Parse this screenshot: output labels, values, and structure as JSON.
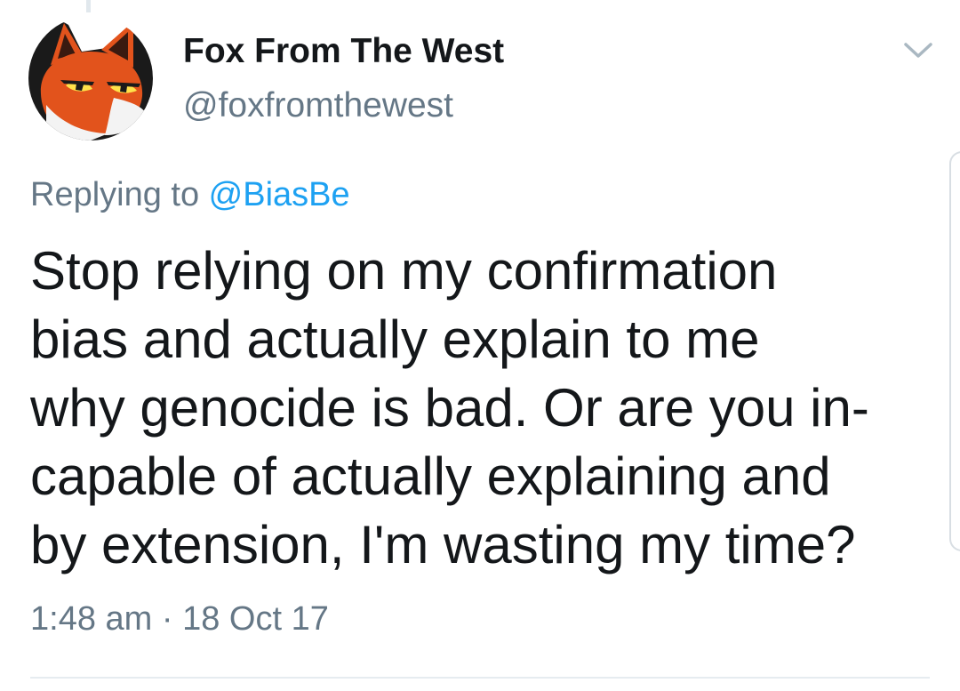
{
  "tweet": {
    "author": {
      "display_name": "Fox From The West",
      "handle": "@foxfromthewest",
      "avatar_icon": "fox-avatar-icon"
    },
    "menu_icon": "chevron-down-icon",
    "reply_prefix": "Replying to ",
    "reply_mention": "@BiasBe",
    "text": "Stop relying on my confirmation\nbias and actually explain to me\nwhy genocide is bad. Or are you in-\ncapable of actually explaining and\nby extension, I'm wasting my time?",
    "timestamp": "1:48 am · 18 Oct 17"
  },
  "colors": {
    "text_primary": "#14171a",
    "text_secondary": "#657786",
    "link": "#1da1f2",
    "divider": "#e6ecf0"
  }
}
